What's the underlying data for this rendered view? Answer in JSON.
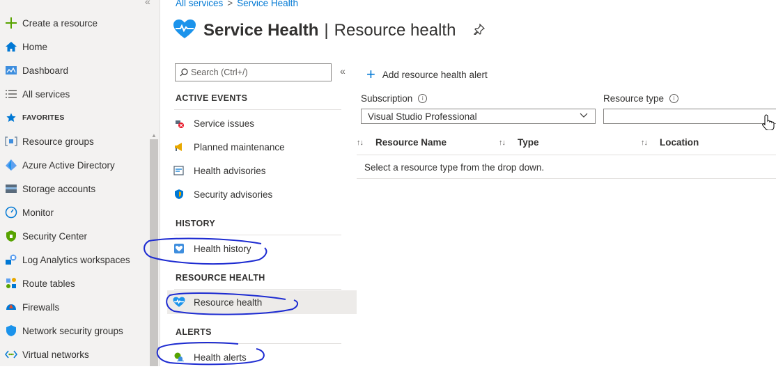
{
  "left_nav": {
    "collapse_glyph": "«",
    "items": [
      {
        "label": "Create a resource",
        "icon": "plus-icon"
      },
      {
        "label": "Home",
        "icon": "home-icon"
      },
      {
        "label": "Dashboard",
        "icon": "dashboard-icon"
      },
      {
        "label": "All services",
        "icon": "list-icon"
      },
      {
        "label": "FAVORITES",
        "icon": "star-icon"
      },
      {
        "label": "Resource groups",
        "icon": "resource-groups-icon"
      },
      {
        "label": "Azure Active Directory",
        "icon": "azure-ad-icon"
      },
      {
        "label": "Storage accounts",
        "icon": "storage-icon"
      },
      {
        "label": "Monitor",
        "icon": "monitor-icon"
      },
      {
        "label": "Security Center",
        "icon": "security-center-icon"
      },
      {
        "label": "Log Analytics workspaces",
        "icon": "log-analytics-icon"
      },
      {
        "label": "Route tables",
        "icon": "route-table-icon"
      },
      {
        "label": "Firewalls",
        "icon": "firewall-icon"
      },
      {
        "label": "Network security groups",
        "icon": "shield-icon"
      },
      {
        "label": "Virtual networks",
        "icon": "vnet-icon"
      }
    ]
  },
  "breadcrumb": [
    "All services",
    "Service Health"
  ],
  "breadcrumb_sep": ">",
  "title": {
    "main": "Service Health",
    "sep": "|",
    "sub": "Resource health"
  },
  "menu": {
    "search_placeholder": "Search (Ctrl+/)",
    "collapse_glyph": "«",
    "sections": [
      {
        "heading": "ACTIVE EVENTS",
        "items": [
          "Service issues",
          "Planned maintenance",
          "Health advisories",
          "Security advisories"
        ]
      },
      {
        "heading": "HISTORY",
        "items": [
          "Health history"
        ]
      },
      {
        "heading": "RESOURCE HEALTH",
        "items": [
          "Resource health"
        ]
      },
      {
        "heading": "ALERTS",
        "items": [
          "Health alerts"
        ]
      }
    ],
    "selected": "Resource health"
  },
  "content": {
    "add_alert_label": "Add resource health alert",
    "subscription_label": "Subscription",
    "subscription_value": "Visual Studio Professional",
    "resource_type_label": "Resource type",
    "resource_type_value": "",
    "columns": [
      "Resource Name",
      "Type",
      "Location"
    ],
    "empty_message": "Select a resource type from the drop down."
  },
  "colors": {
    "accent": "#0078d4",
    "annotation": "#1d2bd1",
    "selected_bg": "#edebe9"
  }
}
